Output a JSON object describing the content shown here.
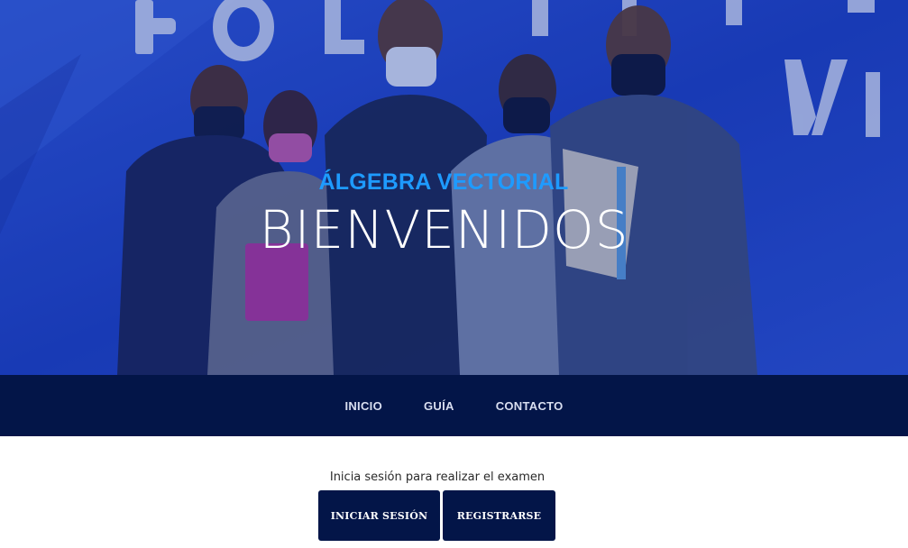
{
  "hero": {
    "subtitle": "ÁLGEBRA VECTORIAL",
    "title": "BIENVENIDOS",
    "background_color": "#1f45c4",
    "subtitle_color": "#1e9bff"
  },
  "nav": {
    "items": [
      {
        "label": "INICIO"
      },
      {
        "label": "GUÍA"
      },
      {
        "label": "CONTACTO"
      }
    ],
    "background_color": "#031548"
  },
  "login": {
    "prompt": "Inicia sesión para realizar el examen",
    "login_label": "INICIAR SESIÓN",
    "register_label": "REGISTRARSE",
    "button_color": "#031548"
  }
}
